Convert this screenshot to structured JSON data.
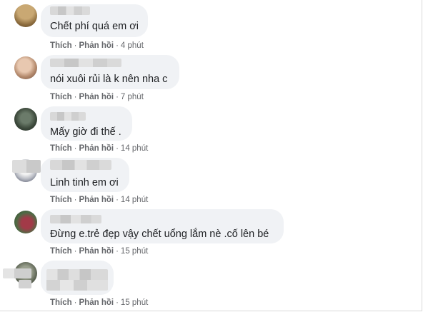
{
  "labels": {
    "like": "Thích",
    "reply": "Phản hồi",
    "sep": "·"
  },
  "comments": [
    {
      "text": "Chết phí quá em ơi",
      "time": "4 phút"
    },
    {
      "text": "nói xuôi rủi là k nên nha c",
      "time": "7 phút"
    },
    {
      "text": "Mấy giờ đi thế .",
      "time": "14 phút"
    },
    {
      "text": "Linh tinh em ơi",
      "time": "14 phút"
    },
    {
      "text": "Đừng e.trẻ đẹp vậy chết uổng lắm nè .cố lên bé",
      "time": "15 phút"
    },
    {
      "text": "",
      "time": "15 phút"
    }
  ],
  "colors": {
    "bubble": "#f0f2f5",
    "meta": "#65676b",
    "text": "#1c1e21"
  }
}
